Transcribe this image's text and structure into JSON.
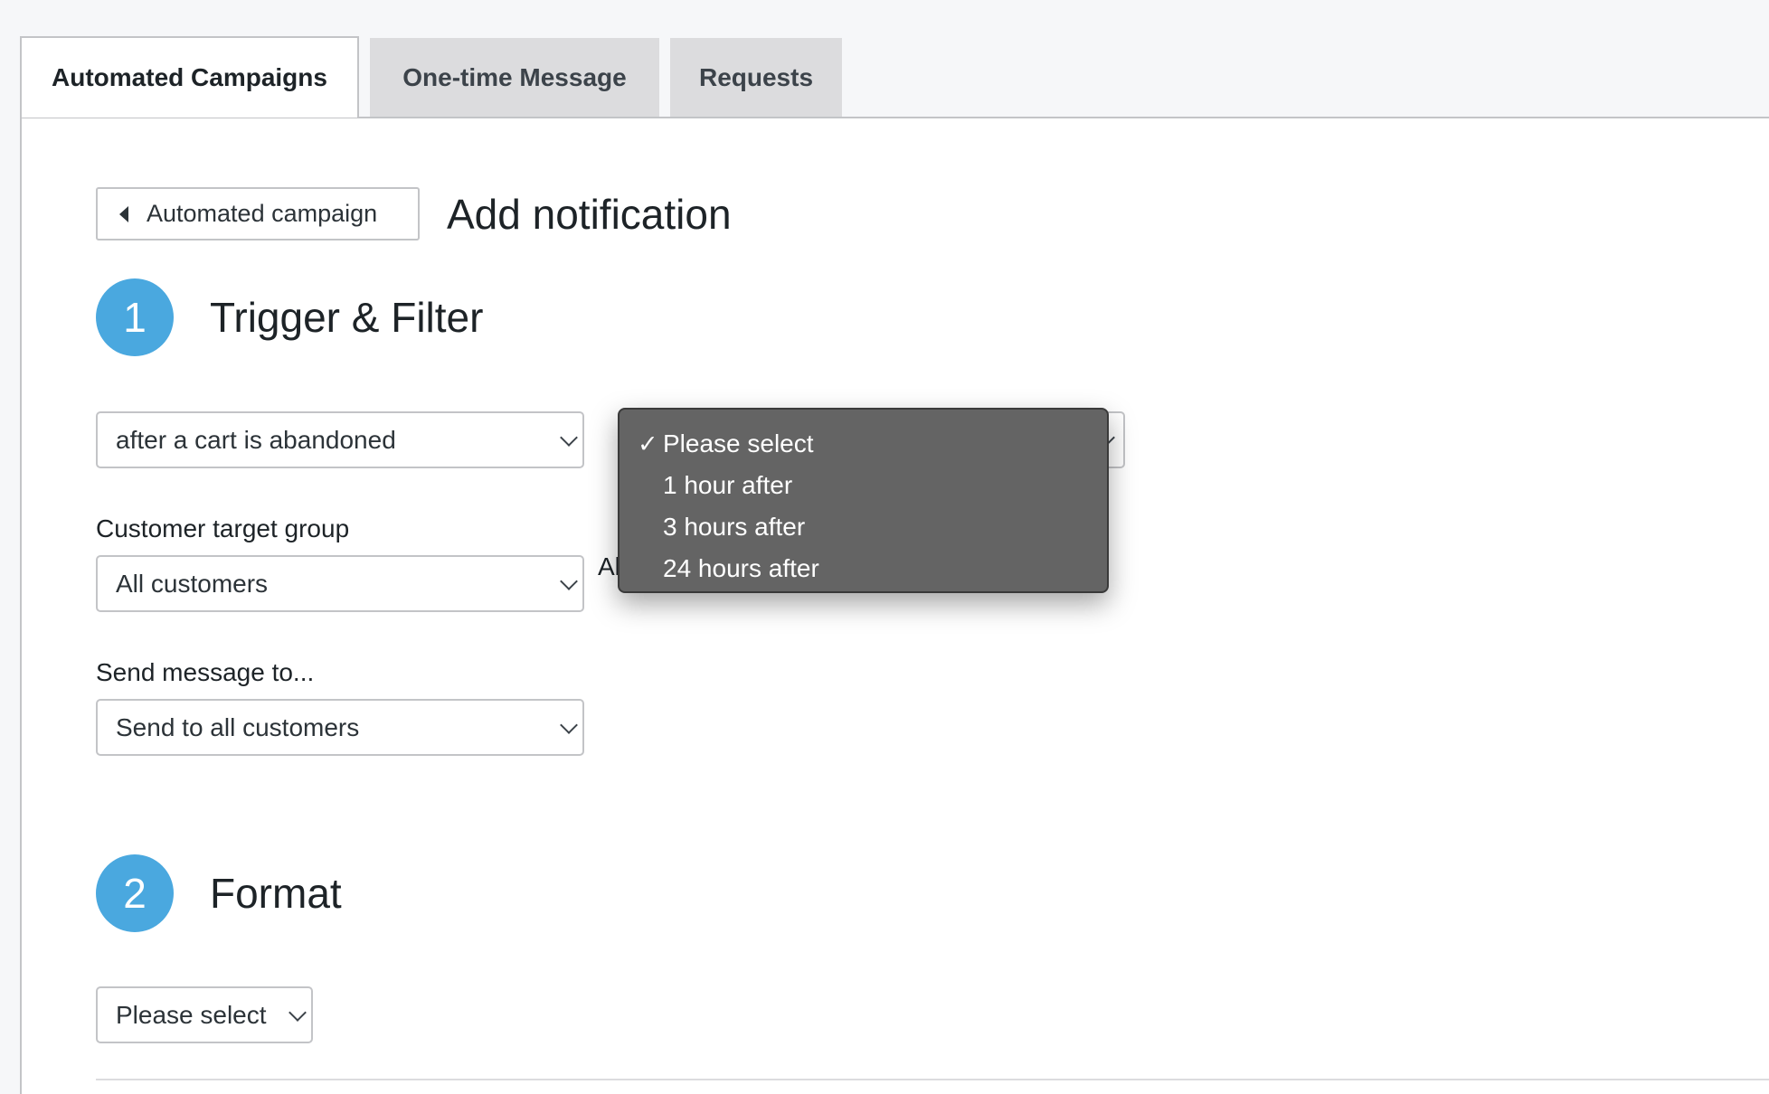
{
  "tabs": [
    {
      "label": "Automated Campaigns",
      "active": true
    },
    {
      "label": "One-time Message",
      "active": false
    },
    {
      "label": "Requests",
      "active": false
    }
  ],
  "header": {
    "back_label": "Automated campaign",
    "title": "Add notification"
  },
  "step1": {
    "number": "1",
    "title": "Trigger & Filter",
    "trigger_select": "after a cart is abandoned",
    "target_group_label": "Customer target group",
    "target_group_select": "All customers",
    "partial_text": "Al",
    "send_to_label": "Send message to...",
    "send_to_select": "Send to all customers"
  },
  "dropdown": {
    "selected_check": "✓",
    "options": [
      "Please select",
      "1 hour after",
      "3 hours after",
      "24 hours after"
    ]
  },
  "step2": {
    "number": "2",
    "title": "Format",
    "format_select": "Please select"
  },
  "colors": {
    "accent": "#4aa8df",
    "dropdown_bg": "#646464"
  }
}
